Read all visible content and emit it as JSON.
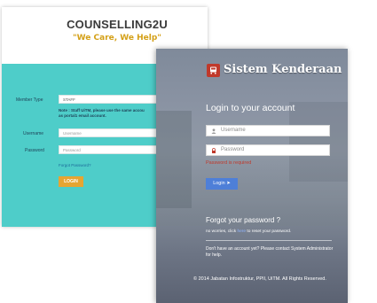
{
  "counselling": {
    "title": "COUNSELLING2U",
    "tagline": "\"We Care, We Help\"",
    "member_type_label": "Member Type",
    "member_type_value": "STAFF",
    "note_line1": "Note : Staff UiTM, please use the same accou",
    "note_line2": "as portal1 email account.",
    "username_label": "Username",
    "username_placeholder": "Username",
    "password_label": "Password",
    "password_placeholder": "Password",
    "forgot_link": "Forgot Password?",
    "login_button": "LOGIN",
    "colors": {
      "panel_bg": "#4ecdc9",
      "title": "#3a3a3a",
      "tagline": "#d4a017",
      "button": "#e6a532"
    }
  },
  "sistem": {
    "brand": "Sistem Kenderaan",
    "logo_icon": "bus-icon",
    "heading": "Login to your account",
    "username_placeholder": "Username",
    "username_icon": "user-icon",
    "password_placeholder": "Password",
    "password_icon": "lock-icon",
    "password_error": "Password is required",
    "login_button": "Login",
    "login_button_icon": "arrow-right-circle-icon",
    "forgot_heading": "Forgot your password ?",
    "reset_prefix": "no worries, click",
    "reset_link": "here",
    "reset_suffix": "to reset your password.",
    "no_account_text": "Don't have an account yet? Please contact System Administrator for help.",
    "footer": "© 2014 Jabatan Infostruktur, PPII, UiTM. All Rights Reserved.",
    "colors": {
      "logo_bg": "#c0392b",
      "button": "#4e7fd8",
      "error": "#c0392b"
    }
  }
}
